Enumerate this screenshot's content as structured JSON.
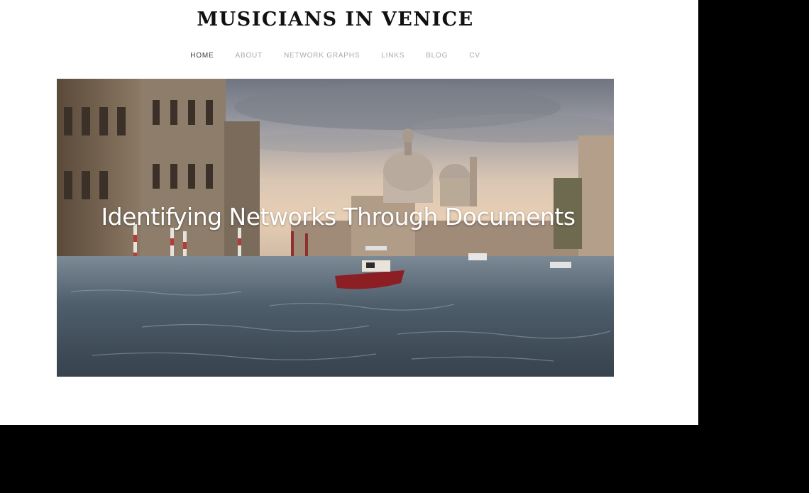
{
  "site": {
    "title": "MUSICIANS IN VENICE"
  },
  "nav": {
    "items": [
      {
        "label": "HOME",
        "active": true
      },
      {
        "label": "ABOUT",
        "active": false
      },
      {
        "label": "NETWORK GRAPHS",
        "active": false
      },
      {
        "label": "LINKS",
        "active": false
      },
      {
        "label": "BLOG",
        "active": false
      },
      {
        "label": "CV",
        "active": false
      }
    ]
  },
  "hero": {
    "heading": "Identifying Networks Through Documents",
    "image_subject": "Grand Canal, Venice, with Santa Maria della Salute and motorboats"
  },
  "colors": {
    "page_background": "#ffffff",
    "outer_background": "#000000",
    "title_color": "#111111",
    "nav_active": "#3a3a3a",
    "nav_inactive": "#a9a9a9",
    "hero_text": "#ffffff"
  }
}
